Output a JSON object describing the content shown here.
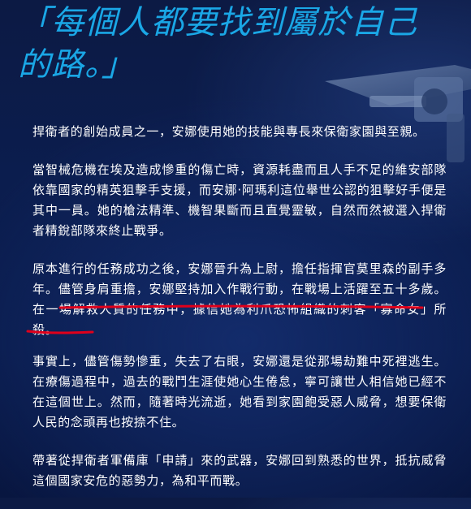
{
  "quote": "「每個人都要找到屬於自己的路。」",
  "paragraphs": {
    "p1": "捍衛者的創始成員之一，安娜使用她的技能與專長來保衛家園與至親。",
    "p2": "當智械危機在埃及造成慘重的傷亡時，資源耗盡而且人手不足的維安部隊依靠國家的精英狙擊手支援，而安娜·阿瑪利這位舉世公認的狙擊好手便是其中一員。她的槍法精準、機智果斷而且直覺靈敏，自然而然被選入捍衛者精銳部隊來終止戰爭。",
    "p3_before": "原本進行的任務成功之後，安娜晉升為上尉，擔任指揮官莫里森的副手多年。儘管身肩重擔，安娜堅持加入作戰行動，在戰場上活躍至五十多歲。",
    "p3_marked": "在一場解救人質的任務中，據信她為利爪恐怖組織的刺客「寡命女」所殺。",
    "p4": "事實上，儘管傷勢慘重，失去了右眼，安娜還是從那場劫難中死裡逃生。在療傷過程中，過去的戰鬥生涯使她心生倦怠，寧可讓世人相信她已經不在這個世上。然而，隨著時光流逝，她看到家園飽受惡人威脅，想要保衛人民的念頭再也按捺不住。",
    "p5": "帶著從捍衛者軍備庫「申請」來的武器，安娜回到熟悉的世界，抵抗威脅這個國家安危的惡勢力，為和平而戰。"
  },
  "colors": {
    "quote": "#1aa7e6",
    "text": "#ffffff",
    "annotation": "#e0001b",
    "background": "#0b1d4e"
  }
}
